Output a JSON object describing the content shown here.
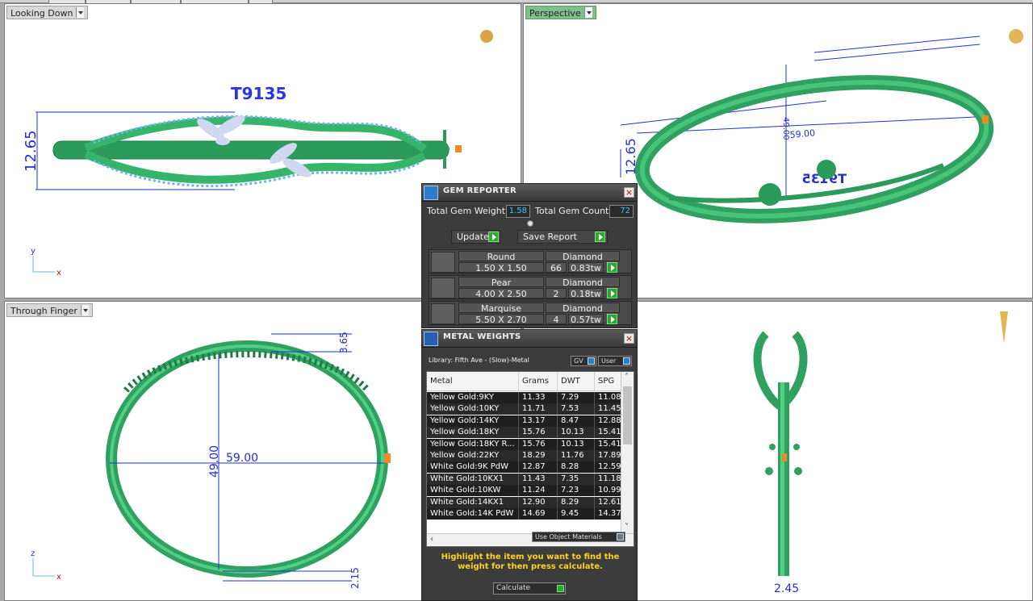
{
  "viewports": {
    "top_left": {
      "title": "Looking Down",
      "label": "T9135",
      "dim_height": "12.65",
      "axis1": "y",
      "axis2": "x"
    },
    "top_right": {
      "title": "Perspective",
      "dim_height": "12.65",
      "dim_49": "49.00",
      "dim_59": "59.00",
      "label_mirror": "T9135"
    },
    "bottom_left": {
      "title": "Through Finger",
      "dim_width": "59.00",
      "dim_height": "49.00",
      "dim_top": "3.65",
      "dim_bottom": "2.15",
      "axis1": "z",
      "axis2": "x"
    },
    "bottom_right": {
      "dim_bottom": "2.45"
    }
  },
  "gem_reporter": {
    "title": "GEM REPORTER",
    "total_weight_label": "Total Gem Weight",
    "total_weight_value": "1.58",
    "total_count_label": "Total Gem Count",
    "total_count_value": "72",
    "update_label": "Update",
    "save_report_label": "Save Report",
    "gems": [
      {
        "shape": "Round",
        "size": "1.50 X 1.50",
        "material": "Diamond",
        "count": "66",
        "tw": "0.83tw"
      },
      {
        "shape": "Pear",
        "size": "4.00 X 2.50",
        "material": "Diamond",
        "count": "2",
        "tw": "0.18tw"
      },
      {
        "shape": "Marquise",
        "size": "5.50 X 2.70",
        "material": "Diamond",
        "count": "4",
        "tw": "0.57tw"
      }
    ]
  },
  "metal_weights": {
    "title": "METAL WEIGHTS",
    "library": "Library: Fifth Ave - (Slow)-Metal",
    "toggle_gv": "GV",
    "toggle_user": "User",
    "columns": [
      "Metal",
      "Grams",
      "DWT",
      "SPG"
    ],
    "rows": [
      [
        "Yellow Gold:9KY",
        "11.33",
        "7.29",
        "11.08"
      ],
      [
        "Yellow Gold:10KY",
        "11.71",
        "7.53",
        "11.45"
      ],
      [
        "Yellow Gold:14KY",
        "13.17",
        "8.47",
        "12.88"
      ],
      [
        "Yellow Gold:18KY",
        "15.76",
        "10.13",
        "15.41"
      ],
      [
        "Yellow Gold:18KY R...",
        "15.76",
        "10.13",
        "15.41"
      ],
      [
        "Yellow Gold:22KY",
        "18.29",
        "11.76",
        "17.89"
      ],
      [
        "White Gold:9K PdW",
        "12.87",
        "8.28",
        "12.59"
      ],
      [
        "White Gold:10KX1",
        "11.43",
        "7.35",
        "11.18"
      ],
      [
        "White Gold:10KW",
        "11.24",
        "7.23",
        "10.99"
      ],
      [
        "White Gold:14KX1",
        "12.90",
        "8.29",
        "12.61"
      ],
      [
        "White Gold:14K PdW",
        "14.69",
        "9.45",
        "14.37"
      ]
    ],
    "use_object_materials": "Use Object Materials",
    "instruction": "Highlight the item you want to find the weight for then press calculate.",
    "calculate_label": "Calculate"
  },
  "colors": {
    "model_green": "#2fa05f",
    "dim_blue": "#1a2bd8",
    "panel_bg": "#3c3c3c",
    "accent_yellow": "#ffd21e",
    "field_cyan": "#37c8ff"
  }
}
